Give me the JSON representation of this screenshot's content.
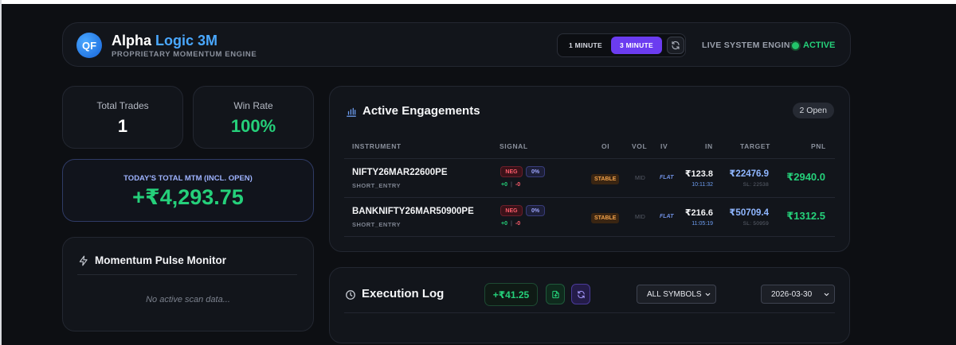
{
  "header": {
    "logo_text": "QF",
    "title_part1": "Alpha",
    "title_part2": "Logic 3M",
    "subtitle": "PROPRIETARY MOMENTUM ENGINE",
    "timeframes": [
      "1 MINUTE",
      "3 MINUTE"
    ],
    "active_timeframe": "3 MINUTE",
    "engine_label": "LIVE SYSTEM ENGINE",
    "engine_status": "ACTIVE",
    "accent_color": "#6b3cf0",
    "status_color": "#25d07a"
  },
  "stats": {
    "total_trades_label": "Total Trades",
    "total_trades_value": "1",
    "win_rate_label": "Win Rate",
    "win_rate_value": "100%"
  },
  "mtm": {
    "label": "TODAY'S TOTAL MTM (INCL. OPEN)",
    "value": "+₹4,293.75"
  },
  "pulse": {
    "title": "Momentum Pulse Monitor",
    "empty_text": "No active scan data..."
  },
  "engagements": {
    "title": "Active Engagements",
    "badge": "2 Open",
    "columns": [
      "INSTRUMENT",
      "SIGNAL",
      "OI",
      "VOL",
      "IV",
      "IN",
      "TARGET",
      "PNL"
    ],
    "rows": [
      {
        "instrument": "NIFTY26MAR22600PE",
        "sub": "SHORT_ENTRY",
        "signal": "NEG",
        "signal_pct": "0%",
        "plus": "+0",
        "minus": "-0",
        "oi": "STABLE",
        "vol": "MID",
        "iv": "FLAT",
        "in_price": "₹123.8",
        "in_time": "10:11:32",
        "target": "₹22476.9",
        "sl": "SL: 22538",
        "pnl": "₹2940.0"
      },
      {
        "instrument": "BANKNIFTY26MAR50900PE",
        "sub": "SHORT_ENTRY",
        "signal": "NEG",
        "signal_pct": "0%",
        "plus": "+0",
        "minus": "-0",
        "oi": "STABLE",
        "vol": "MID",
        "iv": "FLAT",
        "in_price": "₹216.6",
        "in_time": "11:05:19",
        "target": "₹50709.4",
        "sl": "SL: 50959",
        "pnl": "₹1312.5"
      }
    ]
  },
  "execution_log": {
    "title": "Execution Log",
    "pnl": "+₹41.25",
    "symbol_filter": "ALL SYMBOLS",
    "date_filter": "2026-03-30"
  },
  "icons": {
    "logo": "qf-logo-icon",
    "refresh": "refresh-icon",
    "chart": "bar-chart-icon",
    "bolt": "lightning-icon",
    "clock": "clock-icon",
    "export": "file-export-icon",
    "chevron": "chevron-down-icon"
  }
}
